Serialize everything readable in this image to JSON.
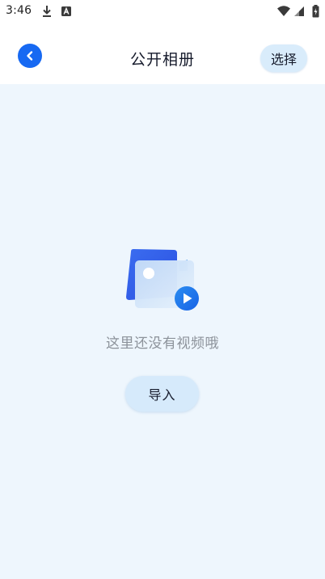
{
  "status_bar": {
    "time": "3:46",
    "icons": [
      "download-icon",
      "text-notification-icon",
      "wifi-icon",
      "signal-icon",
      "battery-icon"
    ]
  },
  "header": {
    "title": "公开相册",
    "select_label": "选择",
    "back_icon": "chevron-left-icon"
  },
  "empty_state": {
    "illustration": "video-gallery-illustration",
    "message": "这里还没有视频哦",
    "import_label": "导入"
  },
  "colors": {
    "accent": "#1769f2",
    "button_bg": "#d6eafb",
    "page_bg": "#eef6fd"
  }
}
